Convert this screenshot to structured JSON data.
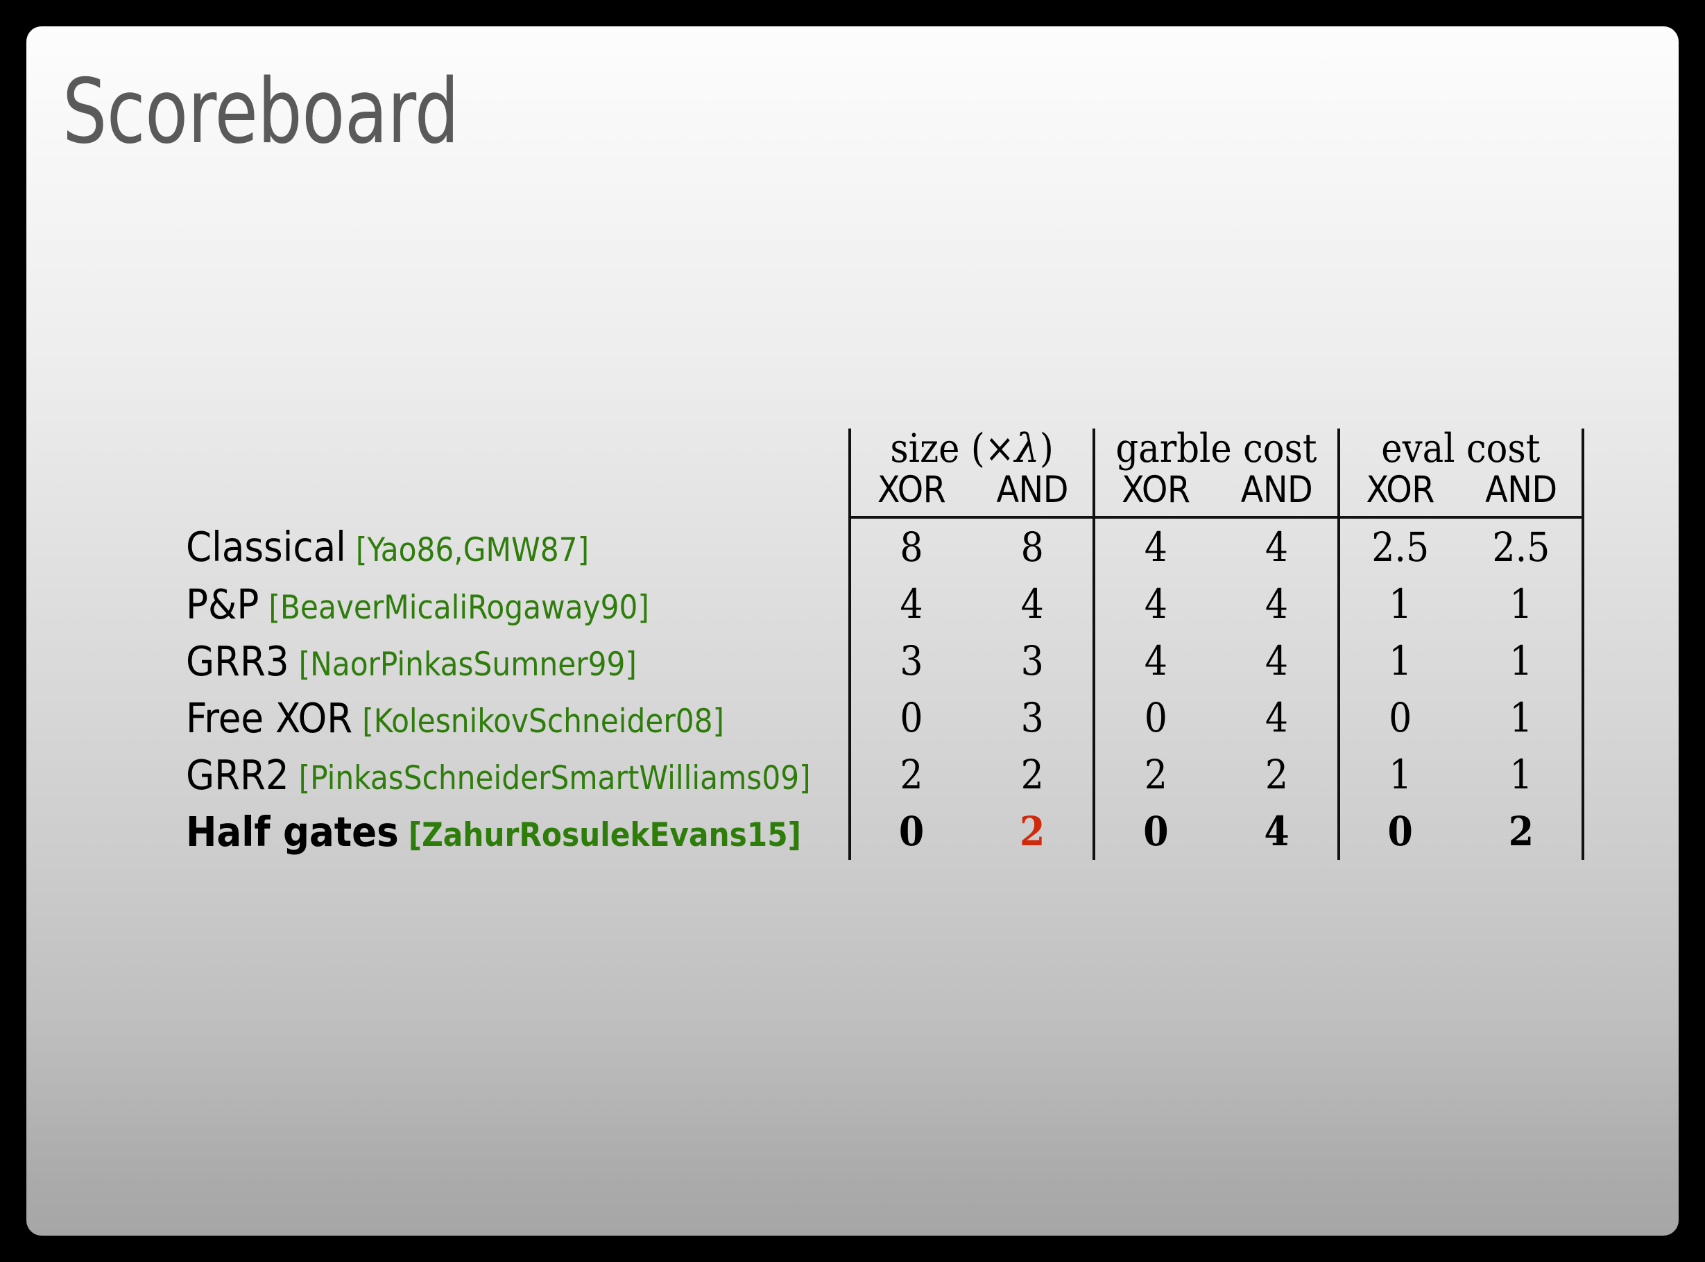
{
  "slide": {
    "title": "Scoreboard",
    "title_color": "#5a5a5a",
    "citation_color": "#2e7d0b",
    "highlight_color": "#cf2a0c"
  },
  "table": {
    "group_headers": [
      {
        "label": "",
        "key": "scheme"
      },
      {
        "label": "size (×λ)",
        "key": "size"
      },
      {
        "label": "garble cost",
        "key": "garble"
      },
      {
        "label": "eval cost",
        "key": "eval"
      }
    ],
    "sub_headers": {
      "xor": "XOR",
      "and": "AND"
    },
    "rows": [
      {
        "name": "Classical",
        "cite": "[Yao86,GMW87]",
        "bold": false,
        "size_xor": "8",
        "size_and": "8",
        "garble_xor": "4",
        "garble_and": "4",
        "eval_xor": "2.5",
        "eval_and": "2.5"
      },
      {
        "name": "P&P",
        "cite": "[BeaverMicaliRogaway90]",
        "bold": false,
        "size_xor": "4",
        "size_and": "4",
        "garble_xor": "4",
        "garble_and": "4",
        "eval_xor": "1",
        "eval_and": "1"
      },
      {
        "name": "GRR3",
        "cite": "[NaorPinkasSumner99]",
        "bold": false,
        "size_xor": "3",
        "size_and": "3",
        "garble_xor": "4",
        "garble_and": "4",
        "eval_xor": "1",
        "eval_and": "1"
      },
      {
        "name": "Free XOR",
        "cite": "[KolesnikovSchneider08]",
        "bold": false,
        "size_xor": "0",
        "size_and": "3",
        "garble_xor": "0",
        "garble_and": "4",
        "eval_xor": "0",
        "eval_and": "1"
      },
      {
        "name": "GRR2",
        "cite": "[PinkasSchneiderSmartWilliams09]",
        "bold": false,
        "size_xor": "2",
        "size_and": "2",
        "garble_xor": "2",
        "garble_and": "2",
        "eval_xor": "1",
        "eval_and": "1"
      },
      {
        "name": "Half gates",
        "cite": "[ZahurRosulekEvans15]",
        "bold": true,
        "size_xor": "0",
        "size_and": "2",
        "garble_xor": "0",
        "garble_and": "4",
        "eval_xor": "0",
        "eval_and": "2"
      }
    ]
  }
}
